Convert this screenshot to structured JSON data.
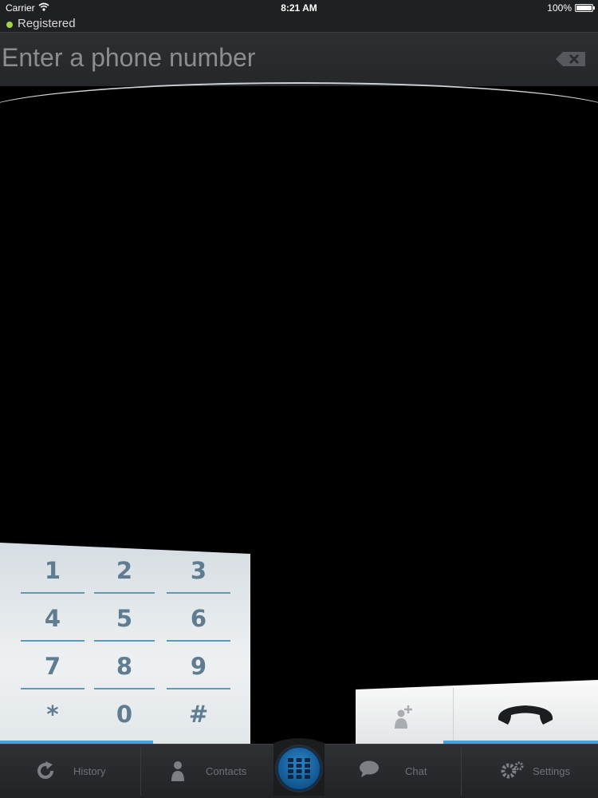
{
  "status_bar": {
    "carrier": "Carrier",
    "time": "8:21 AM",
    "battery": "100%"
  },
  "registration": {
    "status": "Registered",
    "indicator_color": "#a7d34a"
  },
  "number_entry": {
    "placeholder": "Enter a phone number",
    "value": ""
  },
  "keypad": {
    "keys": [
      "1",
      "2",
      "3",
      "4",
      "5",
      "6",
      "7",
      "8",
      "9",
      "*",
      "0",
      "#"
    ]
  },
  "call_panel": {
    "add_contact_icon": "add-contact-icon",
    "call_icon": "phone-handset-icon"
  },
  "tab_bar": {
    "tabs": [
      {
        "label": "History",
        "icon": "refresh-icon"
      },
      {
        "label": "Contacts",
        "icon": "person-icon"
      },
      {
        "label": "Chat",
        "icon": "speech-bubble-icon"
      },
      {
        "label": "Settings",
        "icon": "gears-icon"
      }
    ],
    "center_icon": "dialpad-grid-icon"
  },
  "colors": {
    "accent": "#3fa6d6",
    "keypad_digit": "#5f7c91",
    "background": "#000000",
    "bar": "#2c2e31"
  }
}
